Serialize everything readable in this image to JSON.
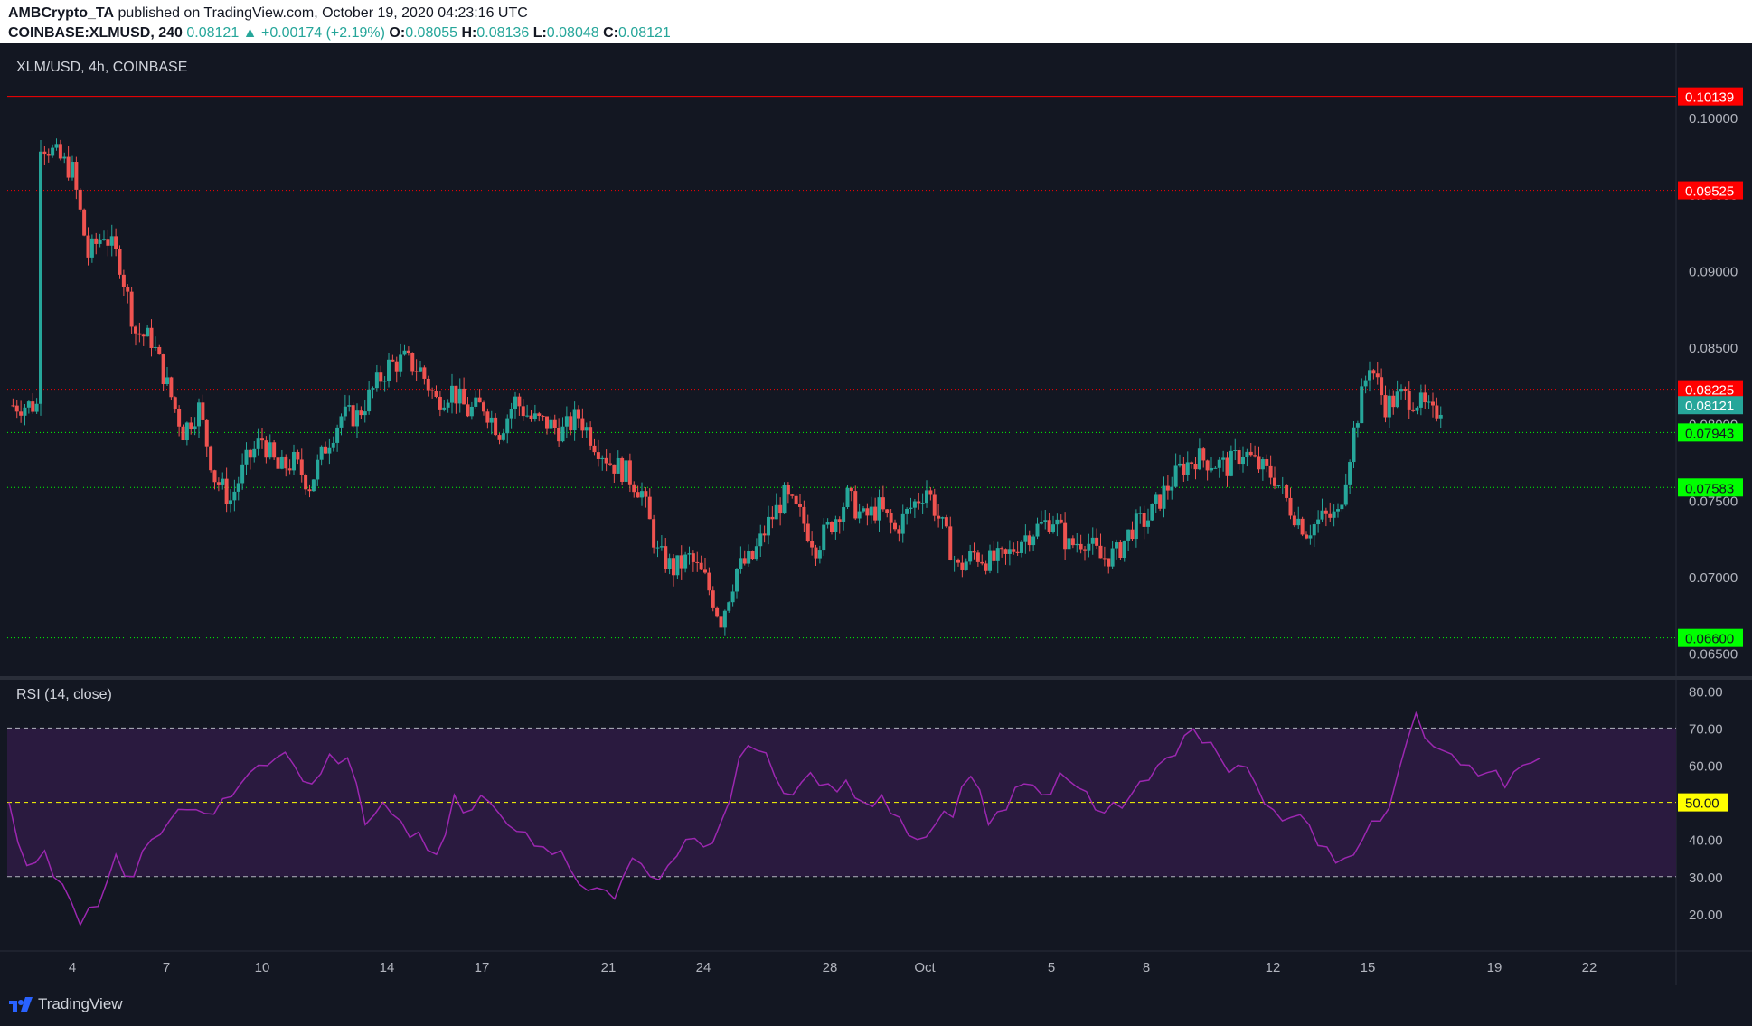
{
  "header": {
    "publisher": "AMBCrypto_TA",
    "published_text": "published on TradingView.com, October 19, 2020 04:23:16 UTC",
    "symbol": "COINBASE:XLMUSD, 240",
    "last": "0.08121",
    "change": "+0.00174 (+2.19%)",
    "o_label": "O:",
    "o": "0.08055",
    "h_label": "H:",
    "h": "0.08136",
    "l_label": "L:",
    "l": "0.08048",
    "c_label": "C:",
    "c": "0.08121"
  },
  "footer": {
    "brand": "TradingView"
  },
  "colors": {
    "background": "#131722",
    "up": "#26a69a",
    "down": "#ef5350",
    "resistance": "#ff0000",
    "support": "#00ff00",
    "rsi_line": "#9c27b0",
    "rsi_band": "#2a1a3f"
  },
  "chart_data": [
    {
      "type": "candlestick",
      "title": "XLM/USD, 4h, COINBASE",
      "x_tick_labels": [
        "4",
        "7",
        "10",
        "14",
        "17",
        "21",
        "24",
        "28",
        "Oct",
        "5",
        "8",
        "12",
        "15",
        "19",
        "22"
      ],
      "y_tick_labels": [
        "0.10000",
        "0.09500",
        "0.09000",
        "0.08500",
        "0.08000",
        "0.07500",
        "0.07000",
        "0.06500"
      ],
      "ylim": [
        0.0635,
        0.1045
      ],
      "current_price": 0.08121,
      "horizontal_levels": [
        {
          "value": 0.10139,
          "label": "0.10139",
          "color": "#ff0000",
          "style": "solid"
        },
        {
          "value": 0.09525,
          "label": "0.09525",
          "color": "#ff0000",
          "style": "dotted"
        },
        {
          "value": 0.08225,
          "label": "0.08225",
          "color": "#ff0000",
          "style": "dotted"
        },
        {
          "value": 0.07943,
          "label": "0.07943",
          "color": "#00ff00",
          "style": "dotted"
        },
        {
          "value": 0.07583,
          "label": "0.07583",
          "color": "#00ff00",
          "style": "dotted"
        },
        {
          "value": 0.066,
          "label": "0.06600",
          "color": "#00ff00",
          "style": "dotted"
        }
      ],
      "price_path": [
        [
          2,
          0.0985
        ],
        [
          4,
          0.0965
        ],
        [
          5,
          0.091
        ],
        [
          6,
          0.0925
        ],
        [
          7,
          0.0905
        ],
        [
          8,
          0.086
        ],
        [
          9,
          0.0855
        ],
        [
          11,
          0.0795
        ],
        [
          12,
          0.081
        ],
        [
          13,
          0.0765
        ],
        [
          14,
          0.075
        ],
        [
          15,
          0.0775
        ],
        [
          16,
          0.079
        ],
        [
          17,
          0.077
        ],
        [
          18,
          0.0775
        ],
        [
          19,
          0.076
        ],
        [
          20,
          0.0785
        ],
        [
          21,
          0.0805
        ],
        [
          22,
          0.0805
        ],
        [
          23,
          0.0822
        ],
        [
          24,
          0.0838
        ],
        [
          25,
          0.0842
        ],
        [
          26,
          0.0835
        ],
        [
          27,
          0.0815
        ],
        [
          28,
          0.0822
        ],
        [
          29,
          0.0808
        ],
        [
          30,
          0.0812
        ],
        [
          31,
          0.0795
        ],
        [
          32,
          0.0815
        ],
        [
          33,
          0.0803
        ],
        [
          34,
          0.08
        ],
        [
          35,
          0.0795
        ],
        [
          36,
          0.0805
        ],
        [
          37,
          0.0788
        ],
        [
          38,
          0.0775
        ],
        [
          39,
          0.0768
        ],
        [
          40,
          0.0755
        ],
        [
          41,
          0.0715
        ],
        [
          42,
          0.0705
        ],
        [
          43,
          0.0712
        ],
        [
          44,
          0.0698
        ],
        [
          45,
          0.0672
        ],
        [
          46,
          0.0705
        ],
        [
          47,
          0.0712
        ],
        [
          48,
          0.0735
        ],
        [
          49,
          0.0752
        ],
        [
          50,
          0.074
        ],
        [
          51,
          0.072
        ],
        [
          52,
          0.0735
        ],
        [
          53,
          0.0752
        ],
        [
          54,
          0.0738
        ],
        [
          55,
          0.0745
        ],
        [
          56,
          0.073
        ],
        [
          57,
          0.0745
        ],
        [
          58,
          0.0758
        ],
        [
          59,
          0.0732
        ],
        [
          60,
          0.0705
        ],
        [
          61,
          0.0715
        ],
        [
          62,
          0.071
        ],
        [
          63,
          0.0712
        ],
        [
          64,
          0.0725
        ],
        [
          65,
          0.0732
        ],
        [
          66,
          0.0738
        ],
        [
          67,
          0.072
        ],
        [
          68,
          0.0725
        ],
        [
          69,
          0.0712
        ],
        [
          70,
          0.0715
        ],
        [
          71,
          0.0732
        ],
        [
          72,
          0.0738
        ],
        [
          73,
          0.0755
        ],
        [
          74,
          0.077
        ],
        [
          75,
          0.0778
        ],
        [
          76,
          0.0775
        ],
        [
          77,
          0.0772
        ],
        [
          78,
          0.0782
        ],
        [
          79,
          0.0772
        ],
        [
          80,
          0.0765
        ],
        [
          81,
          0.0745
        ],
        [
          82,
          0.073
        ],
        [
          83,
          0.0738
        ],
        [
          84,
          0.074
        ],
        [
          85,
          0.0795
        ],
        [
          86,
          0.084
        ],
        [
          87,
          0.0812
        ],
        [
          88,
          0.0818
        ],
        [
          89,
          0.0815
        ],
        [
          90,
          0.0805
        ],
        [
          90.5,
          0.0812
        ]
      ]
    },
    {
      "type": "line",
      "title": "RSI (14, close)",
      "y_tick_labels": [
        "80.00",
        "70.00",
        "60.00",
        "50.00",
        "40.00",
        "30.00",
        "20.00"
      ],
      "ylim": [
        10,
        83
      ],
      "levels": [
        {
          "value": 70,
          "label": "70.00",
          "style": "dashed"
        },
        {
          "value": 50,
          "label": "50.00",
          "style": "dashed",
          "highlight": "#ffff00"
        },
        {
          "value": 30,
          "label": "30.00",
          "style": "dashed"
        }
      ],
      "band": [
        30,
        70
      ],
      "rsi_path": [
        [
          0,
          50
        ],
        [
          1,
          33
        ],
        [
          2,
          37
        ],
        [
          3,
          28
        ],
        [
          4,
          17
        ],
        [
          5,
          22
        ],
        [
          6,
          36
        ],
        [
          7,
          30
        ],
        [
          8,
          40
        ],
        [
          9,
          45
        ],
        [
          10,
          48
        ],
        [
          11,
          47
        ],
        [
          12,
          51
        ],
        [
          13,
          55
        ],
        [
          14,
          60
        ],
        [
          15,
          62
        ],
        [
          16,
          60
        ],
        [
          17,
          55
        ],
        [
          18,
          63
        ],
        [
          19,
          62
        ],
        [
          20,
          44
        ],
        [
          21,
          50
        ],
        [
          22,
          45
        ],
        [
          23,
          42
        ],
        [
          24,
          36
        ],
        [
          25,
          52
        ],
        [
          26,
          48
        ],
        [
          27,
          50
        ],
        [
          28,
          44
        ],
        [
          29,
          42
        ],
        [
          30,
          38
        ],
        [
          31,
          37
        ],
        [
          32,
          28
        ],
        [
          33,
          27
        ],
        [
          34,
          24
        ],
        [
          35,
          35
        ],
        [
          36,
          30
        ],
        [
          37,
          33
        ],
        [
          38,
          40
        ],
        [
          39,
          38
        ],
        [
          40,
          45
        ],
        [
          41,
          62
        ],
        [
          42,
          64
        ],
        [
          43,
          57
        ],
        [
          44,
          52
        ],
        [
          45,
          58
        ],
        [
          46,
          55
        ],
        [
          47,
          56
        ],
        [
          48,
          50
        ],
        [
          49,
          52
        ],
        [
          50,
          46
        ],
        [
          51,
          40
        ],
        [
          52,
          44
        ],
        [
          53,
          46
        ],
        [
          54,
          57
        ],
        [
          55,
          44
        ],
        [
          56,
          48
        ],
        [
          57,
          55
        ],
        [
          58,
          52
        ],
        [
          59,
          58
        ],
        [
          60,
          54
        ],
        [
          61,
          48
        ],
        [
          62,
          50
        ],
        [
          63,
          52
        ],
        [
          64,
          56
        ],
        [
          65,
          62
        ],
        [
          66,
          68
        ],
        [
          67,
          66
        ],
        [
          68,
          62
        ],
        [
          69,
          60
        ],
        [
          70,
          55
        ],
        [
          71,
          48
        ],
        [
          72,
          46
        ],
        [
          73,
          44
        ],
        [
          74,
          38
        ],
        [
          75,
          35
        ],
        [
          76,
          40
        ],
        [
          77,
          45
        ],
        [
          78,
          58
        ],
        [
          79,
          74
        ],
        [
          80,
          65
        ],
        [
          81,
          63
        ],
        [
          82,
          60
        ],
        [
          83,
          58
        ],
        [
          84,
          54
        ],
        [
          85,
          60
        ],
        [
          86,
          62
        ]
      ]
    }
  ]
}
